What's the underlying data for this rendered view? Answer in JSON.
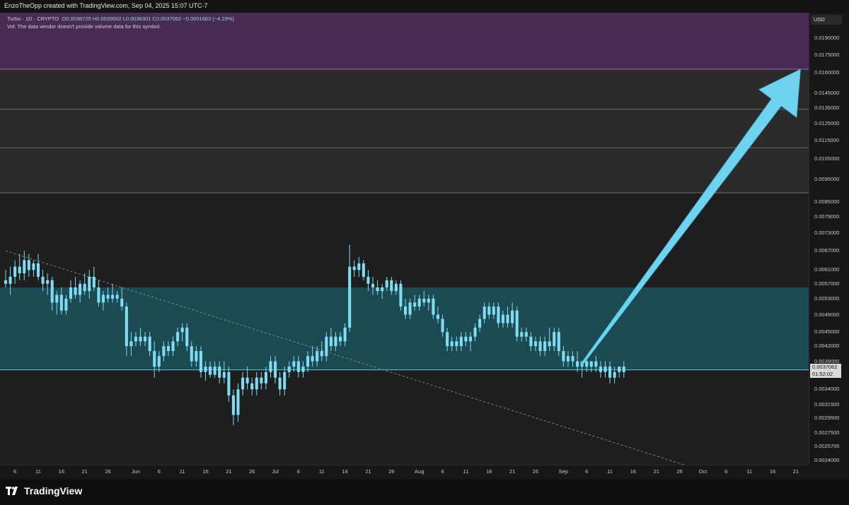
{
  "header": {
    "credit": "EnzoTheOpp created with TradingView.com, Sep 04, 2025 15:07 UTC-7"
  },
  "legend": {
    "symbol": "Turbo · 1D · CRYPTO",
    "ohlc": "O0.0038725 H0.0039002 L0.0036301 C0.0037062 −0.0001663 (−4.29%)",
    "volume_note": "Vol: The data vendor doesn't provide volume data for this symbol."
  },
  "price_axis": {
    "currency": "USD",
    "ticks": [
      "0.0190000",
      "0.0175000",
      "0.0160000",
      "0.0145000",
      "0.0135000",
      "0.0125000",
      "0.0115000",
      "0.0105000",
      "0.0095000",
      "0.0085000",
      "0.0079000",
      "0.0073000",
      "0.0067000",
      "0.0061000",
      "0.0057000",
      "0.0053000",
      "0.0049000",
      "0.0045000",
      "0.0042000",
      "0.0039000",
      "0.0034000",
      "0.0031500",
      "0.0029500",
      "0.0027500",
      "0.0025700",
      "0.0024000"
    ],
    "current_price": "0.0037062",
    "countdown": "01:52:02"
  },
  "time_axis": {
    "ticks": [
      "6",
      "11",
      "16",
      "21",
      "26",
      "Jun",
      "6",
      "11",
      "16",
      "21",
      "26",
      "Jul",
      "6",
      "11",
      "16",
      "21",
      "26",
      "Aug",
      "6",
      "11",
      "16",
      "21",
      "26",
      "Sep",
      "6",
      "11",
      "16",
      "21",
      "26",
      "Oct",
      "6",
      "11",
      "16",
      "21"
    ]
  },
  "footer": {
    "brand": "TradingView"
  },
  "colors": {
    "candle": "#7fdcf3",
    "arrow": "#6fd3f0",
    "support_zone": "#1c4a52",
    "target_zone": "#4a2b53",
    "background": "#1e1e1e"
  },
  "chart_data": {
    "type": "candlestick",
    "title": "",
    "xlabel": "",
    "ylabel": "",
    "scale": "log",
    "ylim": [
      0.00235,
      0.0215
    ],
    "x_range_dates": [
      "2025-05-04",
      "2025-10-23"
    ],
    "zones": [
      {
        "name": "target-zone",
        "low": 0.0163,
        "high": 0.0215
      },
      {
        "name": "support-zone",
        "low": 0.00374,
        "high": 0.0056
      }
    ],
    "horizontal_levels": [
      0.0134,
      0.0111,
      0.0089
    ],
    "trendline": {
      "from": [
        "2025-05-04",
        0.0067
      ],
      "to": [
        "2025-09-27",
        0.00235
      ]
    },
    "projection_arrow": {
      "from": [
        "2025-09-05",
        0.00385
      ],
      "to": [
        "2025-10-22",
        0.0163
      ]
    },
    "candles": [
      {
        "date": "2025-05-04",
        "o": 0.0058,
        "h": 0.0061,
        "l": 0.0056,
        "c": 0.0057
      },
      {
        "date": "2025-05-05",
        "o": 0.0057,
        "h": 0.0062,
        "l": 0.0054,
        "c": 0.0059
      },
      {
        "date": "2025-05-06",
        "o": 0.0059,
        "h": 0.0064,
        "l": 0.0057,
        "c": 0.0062
      },
      {
        "date": "2025-05-07",
        "o": 0.0062,
        "h": 0.0066,
        "l": 0.0058,
        "c": 0.006
      },
      {
        "date": "2025-05-08",
        "o": 0.006,
        "h": 0.0067,
        "l": 0.0058,
        "c": 0.0064
      },
      {
        "date": "2025-05-09",
        "o": 0.0064,
        "h": 0.0066,
        "l": 0.0059,
        "c": 0.0061
      },
      {
        "date": "2025-05-10",
        "o": 0.0061,
        "h": 0.0064,
        "l": 0.0059,
        "c": 0.0063
      },
      {
        "date": "2025-05-11",
        "o": 0.0063,
        "h": 0.0066,
        "l": 0.0058,
        "c": 0.0059
      },
      {
        "date": "2025-05-12",
        "o": 0.0059,
        "h": 0.0061,
        "l": 0.0055,
        "c": 0.0057
      },
      {
        "date": "2025-05-13",
        "o": 0.0057,
        "h": 0.006,
        "l": 0.0054,
        "c": 0.0058
      },
      {
        "date": "2025-05-14",
        "o": 0.0058,
        "h": 0.0059,
        "l": 0.005,
        "c": 0.0052
      },
      {
        "date": "2025-05-15",
        "o": 0.0052,
        "h": 0.0055,
        "l": 0.0049,
        "c": 0.0054
      },
      {
        "date": "2025-05-16",
        "o": 0.0054,
        "h": 0.0056,
        "l": 0.0049,
        "c": 0.005
      },
      {
        "date": "2025-05-17",
        "o": 0.005,
        "h": 0.0054,
        "l": 0.0049,
        "c": 0.0053
      },
      {
        "date": "2025-05-18",
        "o": 0.0053,
        "h": 0.0058,
        "l": 0.0052,
        "c": 0.0056
      },
      {
        "date": "2025-05-19",
        "o": 0.0056,
        "h": 0.0059,
        "l": 0.0053,
        "c": 0.0054
      },
      {
        "date": "2025-05-20",
        "o": 0.0054,
        "h": 0.0058,
        "l": 0.0052,
        "c": 0.0057
      },
      {
        "date": "2025-05-21",
        "o": 0.0057,
        "h": 0.006,
        "l": 0.0054,
        "c": 0.0055
      },
      {
        "date": "2025-05-22",
        "o": 0.0055,
        "h": 0.0061,
        "l": 0.0053,
        "c": 0.0059
      },
      {
        "date": "2025-05-23",
        "o": 0.0059,
        "h": 0.0062,
        "l": 0.0055,
        "c": 0.0056
      },
      {
        "date": "2025-05-24",
        "o": 0.0056,
        "h": 0.0058,
        "l": 0.0051,
        "c": 0.0052
      },
      {
        "date": "2025-05-25",
        "o": 0.0052,
        "h": 0.0055,
        "l": 0.005,
        "c": 0.0054
      },
      {
        "date": "2025-05-26",
        "o": 0.0054,
        "h": 0.0056,
        "l": 0.0052,
        "c": 0.0053
      },
      {
        "date": "2025-05-27",
        "o": 0.0053,
        "h": 0.0057,
        "l": 0.0052,
        "c": 0.0054
      },
      {
        "date": "2025-05-28",
        "o": 0.0054,
        "h": 0.0055,
        "l": 0.0052,
        "c": 0.0053
      },
      {
        "date": "2025-05-29",
        "o": 0.0053,
        "h": 0.0056,
        "l": 0.005,
        "c": 0.0051
      },
      {
        "date": "2025-05-30",
        "o": 0.0051,
        "h": 0.0052,
        "l": 0.004,
        "c": 0.0042
      },
      {
        "date": "2025-05-31",
        "o": 0.0042,
        "h": 0.0045,
        "l": 0.004,
        "c": 0.0043
      },
      {
        "date": "2025-06-01",
        "o": 0.0043,
        "h": 0.0045,
        "l": 0.0042,
        "c": 0.0044
      },
      {
        "date": "2025-06-02",
        "o": 0.0044,
        "h": 0.0046,
        "l": 0.0042,
        "c": 0.0043
      },
      {
        "date": "2025-06-03",
        "o": 0.0043,
        "h": 0.0045,
        "l": 0.0042,
        "c": 0.0044
      },
      {
        "date": "2025-06-04",
        "o": 0.0044,
        "h": 0.0045,
        "l": 0.004,
        "c": 0.0041
      },
      {
        "date": "2025-06-05",
        "o": 0.0041,
        "h": 0.0043,
        "l": 0.0036,
        "c": 0.0038
      },
      {
        "date": "2025-06-06",
        "o": 0.0038,
        "h": 0.0041,
        "l": 0.0037,
        "c": 0.004
      },
      {
        "date": "2025-06-07",
        "o": 0.004,
        "h": 0.0043,
        "l": 0.0039,
        "c": 0.0042
      },
      {
        "date": "2025-06-08",
        "o": 0.0042,
        "h": 0.0043,
        "l": 0.004,
        "c": 0.0041
      },
      {
        "date": "2025-06-09",
        "o": 0.0041,
        "h": 0.0044,
        "l": 0.004,
        "c": 0.0043
      },
      {
        "date": "2025-06-10",
        "o": 0.0043,
        "h": 0.0046,
        "l": 0.0042,
        "c": 0.0045
      },
      {
        "date": "2025-06-11",
        "o": 0.0045,
        "h": 0.0047,
        "l": 0.0043,
        "c": 0.0046
      },
      {
        "date": "2025-06-12",
        "o": 0.0046,
        "h": 0.0047,
        "l": 0.0041,
        "c": 0.0042
      },
      {
        "date": "2025-06-13",
        "o": 0.0042,
        "h": 0.0043,
        "l": 0.0038,
        "c": 0.0039
      },
      {
        "date": "2025-06-14",
        "o": 0.0039,
        "h": 0.0042,
        "l": 0.0038,
        "c": 0.0041
      },
      {
        "date": "2025-06-15",
        "o": 0.0041,
        "h": 0.0042,
        "l": 0.0036,
        "c": 0.0037
      },
      {
        "date": "2025-06-16",
        "o": 0.0037,
        "h": 0.0039,
        "l": 0.00355,
        "c": 0.0038
      },
      {
        "date": "2025-06-17",
        "o": 0.0038,
        "h": 0.0039,
        "l": 0.0036,
        "c": 0.00365
      },
      {
        "date": "2025-06-18",
        "o": 0.00365,
        "h": 0.0039,
        "l": 0.0036,
        "c": 0.0038
      },
      {
        "date": "2025-06-19",
        "o": 0.0038,
        "h": 0.0039,
        "l": 0.0035,
        "c": 0.0036
      },
      {
        "date": "2025-06-20",
        "o": 0.0036,
        "h": 0.0039,
        "l": 0.0035,
        "c": 0.0037
      },
      {
        "date": "2025-06-21",
        "o": 0.0037,
        "h": 0.0038,
        "l": 0.0032,
        "c": 0.0033
      },
      {
        "date": "2025-06-22",
        "o": 0.0033,
        "h": 0.0034,
        "l": 0.00285,
        "c": 0.003
      },
      {
        "date": "2025-06-23",
        "o": 0.003,
        "h": 0.0035,
        "l": 0.0029,
        "c": 0.0034
      },
      {
        "date": "2025-06-24",
        "o": 0.0034,
        "h": 0.0037,
        "l": 0.0033,
        "c": 0.0036
      },
      {
        "date": "2025-06-25",
        "o": 0.0036,
        "h": 0.0038,
        "l": 0.0034,
        "c": 0.0035
      },
      {
        "date": "2025-06-26",
        "o": 0.0035,
        "h": 0.0036,
        "l": 0.0033,
        "c": 0.0034
      },
      {
        "date": "2025-06-27",
        "o": 0.0034,
        "h": 0.0037,
        "l": 0.0033,
        "c": 0.0036
      },
      {
        "date": "2025-06-28",
        "o": 0.0036,
        "h": 0.0037,
        "l": 0.0034,
        "c": 0.0035
      },
      {
        "date": "2025-06-29",
        "o": 0.0035,
        "h": 0.0038,
        "l": 0.0034,
        "c": 0.0037
      },
      {
        "date": "2025-06-30",
        "o": 0.0037,
        "h": 0.004,
        "l": 0.0036,
        "c": 0.0039
      },
      {
        "date": "2025-07-01",
        "o": 0.0039,
        "h": 0.004,
        "l": 0.0035,
        "c": 0.0036
      },
      {
        "date": "2025-07-02",
        "o": 0.0036,
        "h": 0.0037,
        "l": 0.0033,
        "c": 0.0034
      },
      {
        "date": "2025-07-03",
        "o": 0.0034,
        "h": 0.0038,
        "l": 0.0033,
        "c": 0.0037
      },
      {
        "date": "2025-07-04",
        "o": 0.0037,
        "h": 0.0039,
        "l": 0.0036,
        "c": 0.0038
      },
      {
        "date": "2025-07-05",
        "o": 0.0038,
        "h": 0.004,
        "l": 0.0037,
        "c": 0.0039
      },
      {
        "date": "2025-07-06",
        "o": 0.0039,
        "h": 0.004,
        "l": 0.0036,
        "c": 0.0037
      },
      {
        "date": "2025-07-07",
        "o": 0.0037,
        "h": 0.0039,
        "l": 0.0036,
        "c": 0.0038
      },
      {
        "date": "2025-07-08",
        "o": 0.0038,
        "h": 0.0041,
        "l": 0.0037,
        "c": 0.004
      },
      {
        "date": "2025-07-09",
        "o": 0.004,
        "h": 0.0042,
        "l": 0.0038,
        "c": 0.0039
      },
      {
        "date": "2025-07-10",
        "o": 0.0039,
        "h": 0.0042,
        "l": 0.0038,
        "c": 0.0041
      },
      {
        "date": "2025-07-11",
        "o": 0.0041,
        "h": 0.0043,
        "l": 0.0039,
        "c": 0.004
      },
      {
        "date": "2025-07-12",
        "o": 0.004,
        "h": 0.0045,
        "l": 0.0039,
        "c": 0.0044
      },
      {
        "date": "2025-07-13",
        "o": 0.0044,
        "h": 0.0046,
        "l": 0.0041,
        "c": 0.0042
      },
      {
        "date": "2025-07-14",
        "o": 0.0042,
        "h": 0.0045,
        "l": 0.0041,
        "c": 0.0044
      },
      {
        "date": "2025-07-15",
        "o": 0.0044,
        "h": 0.0045,
        "l": 0.0042,
        "c": 0.0043
      },
      {
        "date": "2025-07-16",
        "o": 0.0043,
        "h": 0.0047,
        "l": 0.0042,
        "c": 0.0046
      },
      {
        "date": "2025-07-17",
        "o": 0.0046,
        "h": 0.0069,
        "l": 0.0045,
        "c": 0.0062
      },
      {
        "date": "2025-07-18",
        "o": 0.0062,
        "h": 0.0064,
        "l": 0.0059,
        "c": 0.0061
      },
      {
        "date": "2025-07-19",
        "o": 0.0061,
        "h": 0.0065,
        "l": 0.0059,
        "c": 0.0063
      },
      {
        "date": "2025-07-20",
        "o": 0.0063,
        "h": 0.0064,
        "l": 0.0058,
        "c": 0.0059
      },
      {
        "date": "2025-07-21",
        "o": 0.0059,
        "h": 0.0061,
        "l": 0.0055,
        "c": 0.0057
      },
      {
        "date": "2025-07-22",
        "o": 0.0057,
        "h": 0.0059,
        "l": 0.0054,
        "c": 0.0056
      },
      {
        "date": "2025-07-23",
        "o": 0.0056,
        "h": 0.0058,
        "l": 0.0054,
        "c": 0.0055
      },
      {
        "date": "2025-07-24",
        "o": 0.0055,
        "h": 0.0057,
        "l": 0.0053,
        "c": 0.0056
      },
      {
        "date": "2025-07-25",
        "o": 0.0056,
        "h": 0.0059,
        "l": 0.0055,
        "c": 0.0058
      },
      {
        "date": "2025-07-26",
        "o": 0.0058,
        "h": 0.0059,
        "l": 0.0054,
        "c": 0.0055
      },
      {
        "date": "2025-07-27",
        "o": 0.0055,
        "h": 0.0058,
        "l": 0.0054,
        "c": 0.0057
      },
      {
        "date": "2025-07-28",
        "o": 0.0057,
        "h": 0.0058,
        "l": 0.005,
        "c": 0.0051
      },
      {
        "date": "2025-07-29",
        "o": 0.0051,
        "h": 0.0053,
        "l": 0.0048,
        "c": 0.0049
      },
      {
        "date": "2025-07-30",
        "o": 0.0049,
        "h": 0.0053,
        "l": 0.0048,
        "c": 0.0052
      },
      {
        "date": "2025-07-31",
        "o": 0.0052,
        "h": 0.0054,
        "l": 0.005,
        "c": 0.0051
      },
      {
        "date": "2025-08-01",
        "o": 0.0051,
        "h": 0.0054,
        "l": 0.005,
        "c": 0.0053
      },
      {
        "date": "2025-08-02",
        "o": 0.0053,
        "h": 0.0055,
        "l": 0.0051,
        "c": 0.0052
      },
      {
        "date": "2025-08-03",
        "o": 0.0052,
        "h": 0.0054,
        "l": 0.005,
        "c": 0.0053
      },
      {
        "date": "2025-08-04",
        "o": 0.0053,
        "h": 0.0054,
        "l": 0.0048,
        "c": 0.0049
      },
      {
        "date": "2025-08-05",
        "o": 0.0049,
        "h": 0.0051,
        "l": 0.0047,
        "c": 0.0048
      },
      {
        "date": "2025-08-06",
        "o": 0.0048,
        "h": 0.0049,
        "l": 0.0044,
        "c": 0.0045
      },
      {
        "date": "2025-08-07",
        "o": 0.0045,
        "h": 0.0046,
        "l": 0.0041,
        "c": 0.0042
      },
      {
        "date": "2025-08-08",
        "o": 0.0042,
        "h": 0.0044,
        "l": 0.0041,
        "c": 0.0043
      },
      {
        "date": "2025-08-09",
        "o": 0.0043,
        "h": 0.0044,
        "l": 0.0041,
        "c": 0.0042
      },
      {
        "date": "2025-08-10",
        "o": 0.0042,
        "h": 0.0045,
        "l": 0.0041,
        "c": 0.0044
      },
      {
        "date": "2025-08-11",
        "o": 0.0044,
        "h": 0.0045,
        "l": 0.0042,
        "c": 0.0043
      },
      {
        "date": "2025-08-12",
        "o": 0.0043,
        "h": 0.0045,
        "l": 0.0041,
        "c": 0.0044
      },
      {
        "date": "2025-08-13",
        "o": 0.0044,
        "h": 0.0047,
        "l": 0.0043,
        "c": 0.0046
      },
      {
        "date": "2025-08-14",
        "o": 0.0046,
        "h": 0.0049,
        "l": 0.0045,
        "c": 0.0048
      },
      {
        "date": "2025-08-15",
        "o": 0.0048,
        "h": 0.0052,
        "l": 0.0047,
        "c": 0.0051
      },
      {
        "date": "2025-08-16",
        "o": 0.0051,
        "h": 0.0052,
        "l": 0.0048,
        "c": 0.0049
      },
      {
        "date": "2025-08-17",
        "o": 0.0049,
        "h": 0.0052,
        "l": 0.0048,
        "c": 0.0051
      },
      {
        "date": "2025-08-18",
        "o": 0.0051,
        "h": 0.0052,
        "l": 0.0046,
        "c": 0.0047
      },
      {
        "date": "2025-08-19",
        "o": 0.0047,
        "h": 0.005,
        "l": 0.0046,
        "c": 0.0049
      },
      {
        "date": "2025-08-20",
        "o": 0.0049,
        "h": 0.0051,
        "l": 0.0046,
        "c": 0.0047
      },
      {
        "date": "2025-08-21",
        "o": 0.0047,
        "h": 0.0052,
        "l": 0.0046,
        "c": 0.005
      },
      {
        "date": "2025-08-22",
        "o": 0.005,
        "h": 0.0051,
        "l": 0.0043,
        "c": 0.0044
      },
      {
        "date": "2025-08-23",
        "o": 0.0044,
        "h": 0.0046,
        "l": 0.0043,
        "c": 0.0045
      },
      {
        "date": "2025-08-24",
        "o": 0.0045,
        "h": 0.0046,
        "l": 0.0043,
        "c": 0.0044
      },
      {
        "date": "2025-08-25",
        "o": 0.0044,
        "h": 0.0045,
        "l": 0.0041,
        "c": 0.0042
      },
      {
        "date": "2025-08-26",
        "o": 0.0042,
        "h": 0.0044,
        "l": 0.0041,
        "c": 0.0043
      },
      {
        "date": "2025-08-27",
        "o": 0.0043,
        "h": 0.0044,
        "l": 0.004,
        "c": 0.0041
      },
      {
        "date": "2025-08-28",
        "o": 0.0041,
        "h": 0.0044,
        "l": 0.004,
        "c": 0.0043
      },
      {
        "date": "2025-08-29",
        "o": 0.0043,
        "h": 0.0046,
        "l": 0.0041,
        "c": 0.0042
      },
      {
        "date": "2025-08-30",
        "o": 0.0042,
        "h": 0.0046,
        "l": 0.0041,
        "c": 0.0045
      },
      {
        "date": "2025-08-31",
        "o": 0.0045,
        "h": 0.0046,
        "l": 0.004,
        "c": 0.0041
      },
      {
        "date": "2025-09-01",
        "o": 0.0041,
        "h": 0.0042,
        "l": 0.0038,
        "c": 0.0039
      },
      {
        "date": "2025-09-02",
        "o": 0.0039,
        "h": 0.0041,
        "l": 0.0038,
        "c": 0.004
      },
      {
        "date": "2025-09-03",
        "o": 0.004,
        "h": 0.0041,
        "l": 0.0038,
        "c": 0.0039
      },
      {
        "date": "2025-09-04",
        "o": 0.0039,
        "h": 0.0041,
        "l": 0.0037,
        "c": 0.0038
      },
      {
        "date": "2025-09-05",
        "o": 0.0038,
        "h": 0.0039,
        "l": 0.0036,
        "c": 0.0039
      },
      {
        "date": "2025-09-06",
        "o": 0.0039,
        "h": 0.004,
        "l": 0.0037,
        "c": 0.0038
      },
      {
        "date": "2025-09-07",
        "o": 0.0038,
        "h": 0.0039,
        "l": 0.0037,
        "c": 0.0039
      },
      {
        "date": "2025-09-08",
        "o": 0.0039,
        "h": 0.004,
        "l": 0.0037,
        "c": 0.0038
      },
      {
        "date": "2025-09-09",
        "o": 0.0038,
        "h": 0.0039,
        "l": 0.0036,
        "c": 0.0037
      },
      {
        "date": "2025-09-10",
        "o": 0.0037,
        "h": 0.0039,
        "l": 0.0036,
        "c": 0.0038
      },
      {
        "date": "2025-09-11",
        "o": 0.0038,
        "h": 0.0039,
        "l": 0.0035,
        "c": 0.0036
      },
      {
        "date": "2025-09-12",
        "o": 0.0036,
        "h": 0.0038,
        "l": 0.0035,
        "c": 0.0037
      },
      {
        "date": "2025-09-13",
        "o": 0.0037,
        "h": 0.0038,
        "l": 0.0036,
        "c": 0.0038
      },
      {
        "date": "2025-09-14",
        "o": 0.0038,
        "h": 0.0039,
        "l": 0.0036,
        "c": 0.0037
      }
    ]
  }
}
